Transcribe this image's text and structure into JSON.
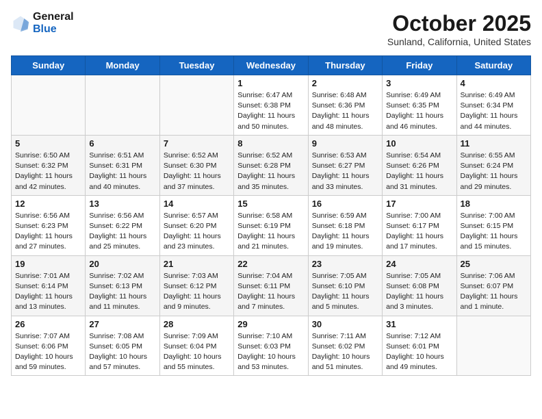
{
  "header": {
    "logo_general": "General",
    "logo_blue": "Blue",
    "title": "October 2025",
    "subtitle": "Sunland, California, United States"
  },
  "days_of_week": [
    "Sunday",
    "Monday",
    "Tuesday",
    "Wednesday",
    "Thursday",
    "Friday",
    "Saturday"
  ],
  "weeks": [
    [
      {
        "day": "",
        "empty": true
      },
      {
        "day": "",
        "empty": true
      },
      {
        "day": "",
        "empty": true
      },
      {
        "day": "1",
        "info": "Sunrise: 6:47 AM\nSunset: 6:38 PM\nDaylight: 11 hours\nand 50 minutes."
      },
      {
        "day": "2",
        "info": "Sunrise: 6:48 AM\nSunset: 6:36 PM\nDaylight: 11 hours\nand 48 minutes."
      },
      {
        "day": "3",
        "info": "Sunrise: 6:49 AM\nSunset: 6:35 PM\nDaylight: 11 hours\nand 46 minutes."
      },
      {
        "day": "4",
        "info": "Sunrise: 6:49 AM\nSunset: 6:34 PM\nDaylight: 11 hours\nand 44 minutes."
      }
    ],
    [
      {
        "day": "5",
        "info": "Sunrise: 6:50 AM\nSunset: 6:32 PM\nDaylight: 11 hours\nand 42 minutes."
      },
      {
        "day": "6",
        "info": "Sunrise: 6:51 AM\nSunset: 6:31 PM\nDaylight: 11 hours\nand 40 minutes."
      },
      {
        "day": "7",
        "info": "Sunrise: 6:52 AM\nSunset: 6:30 PM\nDaylight: 11 hours\nand 37 minutes."
      },
      {
        "day": "8",
        "info": "Sunrise: 6:52 AM\nSunset: 6:28 PM\nDaylight: 11 hours\nand 35 minutes."
      },
      {
        "day": "9",
        "info": "Sunrise: 6:53 AM\nSunset: 6:27 PM\nDaylight: 11 hours\nand 33 minutes."
      },
      {
        "day": "10",
        "info": "Sunrise: 6:54 AM\nSunset: 6:26 PM\nDaylight: 11 hours\nand 31 minutes."
      },
      {
        "day": "11",
        "info": "Sunrise: 6:55 AM\nSunset: 6:24 PM\nDaylight: 11 hours\nand 29 minutes."
      }
    ],
    [
      {
        "day": "12",
        "info": "Sunrise: 6:56 AM\nSunset: 6:23 PM\nDaylight: 11 hours\nand 27 minutes."
      },
      {
        "day": "13",
        "info": "Sunrise: 6:56 AM\nSunset: 6:22 PM\nDaylight: 11 hours\nand 25 minutes."
      },
      {
        "day": "14",
        "info": "Sunrise: 6:57 AM\nSunset: 6:20 PM\nDaylight: 11 hours\nand 23 minutes."
      },
      {
        "day": "15",
        "info": "Sunrise: 6:58 AM\nSunset: 6:19 PM\nDaylight: 11 hours\nand 21 minutes."
      },
      {
        "day": "16",
        "info": "Sunrise: 6:59 AM\nSunset: 6:18 PM\nDaylight: 11 hours\nand 19 minutes."
      },
      {
        "day": "17",
        "info": "Sunrise: 7:00 AM\nSunset: 6:17 PM\nDaylight: 11 hours\nand 17 minutes."
      },
      {
        "day": "18",
        "info": "Sunrise: 7:00 AM\nSunset: 6:15 PM\nDaylight: 11 hours\nand 15 minutes."
      }
    ],
    [
      {
        "day": "19",
        "info": "Sunrise: 7:01 AM\nSunset: 6:14 PM\nDaylight: 11 hours\nand 13 minutes."
      },
      {
        "day": "20",
        "info": "Sunrise: 7:02 AM\nSunset: 6:13 PM\nDaylight: 11 hours\nand 11 minutes."
      },
      {
        "day": "21",
        "info": "Sunrise: 7:03 AM\nSunset: 6:12 PM\nDaylight: 11 hours\nand 9 minutes."
      },
      {
        "day": "22",
        "info": "Sunrise: 7:04 AM\nSunset: 6:11 PM\nDaylight: 11 hours\nand 7 minutes."
      },
      {
        "day": "23",
        "info": "Sunrise: 7:05 AM\nSunset: 6:10 PM\nDaylight: 11 hours\nand 5 minutes."
      },
      {
        "day": "24",
        "info": "Sunrise: 7:05 AM\nSunset: 6:08 PM\nDaylight: 11 hours\nand 3 minutes."
      },
      {
        "day": "25",
        "info": "Sunrise: 7:06 AM\nSunset: 6:07 PM\nDaylight: 11 hours\nand 1 minute."
      }
    ],
    [
      {
        "day": "26",
        "info": "Sunrise: 7:07 AM\nSunset: 6:06 PM\nDaylight: 10 hours\nand 59 minutes."
      },
      {
        "day": "27",
        "info": "Sunrise: 7:08 AM\nSunset: 6:05 PM\nDaylight: 10 hours\nand 57 minutes."
      },
      {
        "day": "28",
        "info": "Sunrise: 7:09 AM\nSunset: 6:04 PM\nDaylight: 10 hours\nand 55 minutes."
      },
      {
        "day": "29",
        "info": "Sunrise: 7:10 AM\nSunset: 6:03 PM\nDaylight: 10 hours\nand 53 minutes."
      },
      {
        "day": "30",
        "info": "Sunrise: 7:11 AM\nSunset: 6:02 PM\nDaylight: 10 hours\nand 51 minutes."
      },
      {
        "day": "31",
        "info": "Sunrise: 7:12 AM\nSunset: 6:01 PM\nDaylight: 10 hours\nand 49 minutes."
      },
      {
        "day": "",
        "empty": true
      }
    ]
  ]
}
